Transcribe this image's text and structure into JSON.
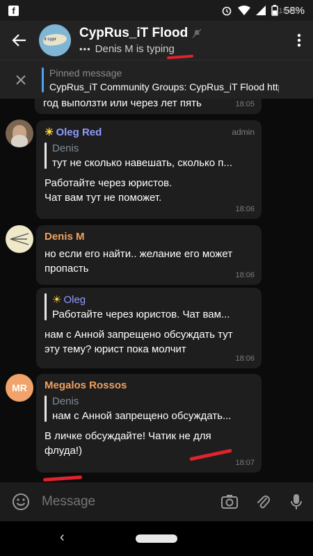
{
  "status": {
    "time": "18:08",
    "battery": "58%"
  },
  "header": {
    "title": "CypRus_iT Flood",
    "avatar_tag": "it cypr",
    "typing": "Denis M is typing"
  },
  "pinned": {
    "title": "Pinned message",
    "text": "CypRus_iT Community  Groups: CypRus_iT Flood   http..."
  },
  "messages": [
    {
      "id": "m0",
      "text": "год выползти или через лет пять",
      "time": "18:05"
    },
    {
      "id": "m1",
      "sender": "Oleg Red",
      "sender_color": "#8f9bff",
      "badge": "admin",
      "reply_name": "Denis",
      "reply_text": "тут не сколько навешать, сколько п...",
      "lines": [
        "Работайте через юристов.",
        "Чат вам тут не поможет."
      ],
      "time": "18:06"
    },
    {
      "id": "m2",
      "sender": "Denis M",
      "sender_color": "#f0a15f",
      "lines": [
        "но если его найти.. желание его может",
        "пропасть"
      ],
      "time": "18:06"
    },
    {
      "id": "m3",
      "reply_name": "Oleg",
      "reply_text": "Работайте через юристов. Чат вам...",
      "lines": [
        "нам с Анной запрещено обсуждать тут",
        "эту тему? юрист пока молчит"
      ],
      "time": "18:06"
    },
    {
      "id": "m4",
      "sender": "Megalos Rossos",
      "sender_color": "#f0a15f",
      "avatar_initials": "MR",
      "reply_name": "Denis",
      "reply_text": "нам с Анной запрещено обсуждать...",
      "lines": [
        "В личке обсуждайте! Чатик не для",
        "флуда!)"
      ],
      "time": "18:07"
    }
  ],
  "input": {
    "placeholder": "Message"
  },
  "colors": {
    "accent": "#4ea1f3",
    "highlight": "#e0232d",
    "bubble": "#1e1e1e"
  }
}
